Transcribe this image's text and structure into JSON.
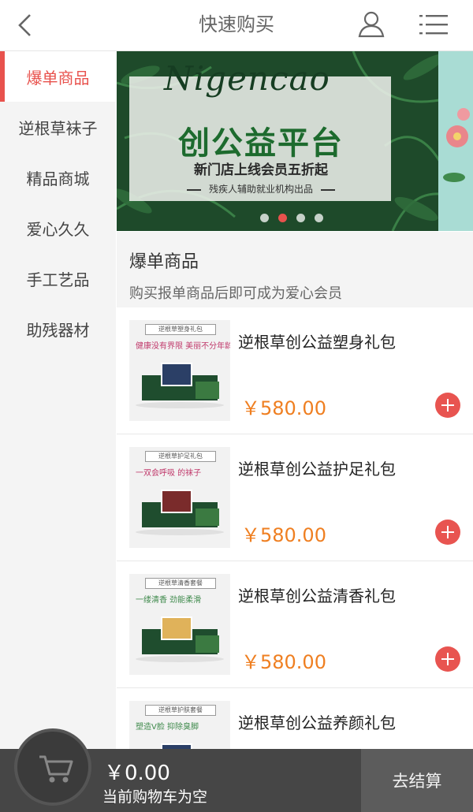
{
  "header": {
    "title": "快速购买",
    "back_icon": "chevron-left-icon",
    "user_icon": "user-icon",
    "menu_icon": "list-menu-icon"
  },
  "sidebar": {
    "items": [
      {
        "label": "爆单商品",
        "active": true
      },
      {
        "label": "逆根草袜子",
        "active": false
      },
      {
        "label": "精品商城",
        "active": false
      },
      {
        "label": "爱心久久",
        "active": false
      },
      {
        "label": "手工艺品",
        "active": false
      },
      {
        "label": "助残器材",
        "active": false
      }
    ]
  },
  "banner": {
    "script_text": "Nigencao",
    "headline": "创公益平台",
    "subline": "新门店上线会员五折起",
    "footnote": "残疾人辅助就业机构出品",
    "slide_count": 4,
    "active_slide": 2
  },
  "section": {
    "title": "爆单商品",
    "description": "购买报单商品后即可成为爱心会员"
  },
  "products": [
    {
      "name": "逆根草创公益塑身礼包",
      "price": "￥580.00",
      "thumb_tag": "逆根草塑身礼包",
      "thumb_slogan": "健康没有界限 美丽不分年龄"
    },
    {
      "name": "逆根草创公益护足礼包",
      "price": "￥580.00",
      "thumb_tag": "逆根草护足礼包",
      "thumb_slogan": "一双会呼吸 的袜子"
    },
    {
      "name": "逆根草创公益清香礼包",
      "price": "￥580.00",
      "thumb_tag": "逆根草清香套餐",
      "thumb_slogan": "一缕清香 劲能柔滑"
    },
    {
      "name": "逆根草创公益养颜礼包",
      "price": "",
      "thumb_tag": "逆根草护肤套餐",
      "thumb_slogan": "塑造V脸 抑除臭脚"
    }
  ],
  "cart": {
    "total": "￥0.00",
    "status": "当前购物车为空",
    "checkout_label": "去结算",
    "cart_icon": "shopping-cart-icon"
  },
  "colors": {
    "accent": "#e8524d",
    "price": "#ef7f21",
    "cartbar": "#464646"
  }
}
